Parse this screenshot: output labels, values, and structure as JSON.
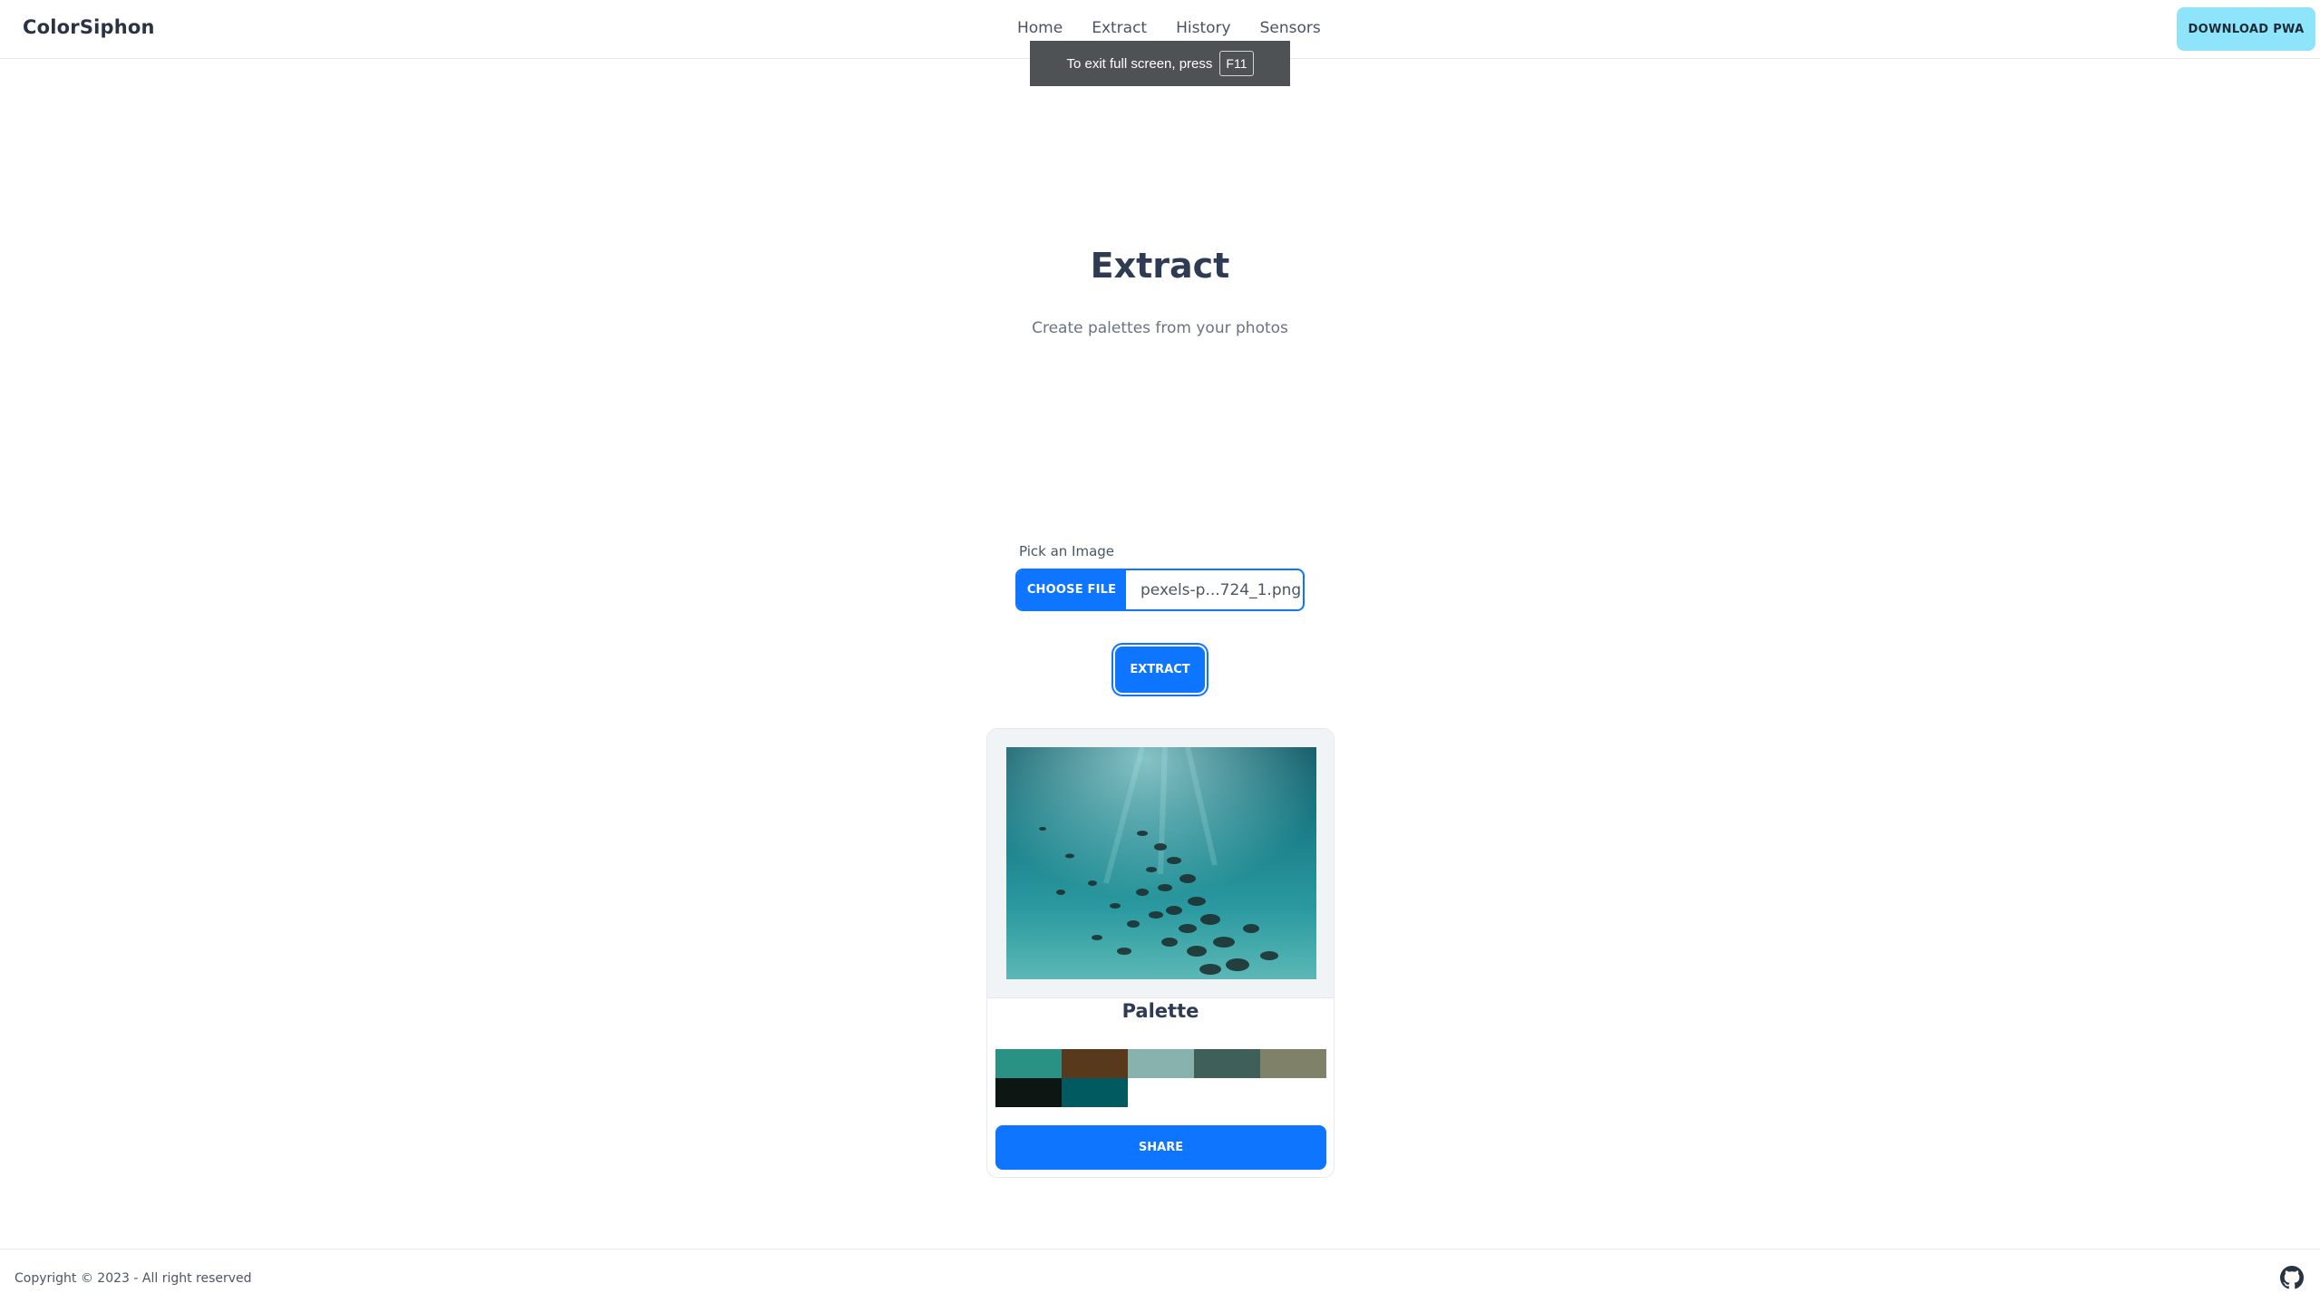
{
  "header": {
    "brand": "ColorSiphon",
    "nav": [
      "Home",
      "Extract",
      "History",
      "Sensors"
    ],
    "download_label": "DOWNLOAD PWA"
  },
  "fullscreen_toast": {
    "text": "To exit full screen, press",
    "key": "F11"
  },
  "hero": {
    "title": "Extract",
    "subtitle": "Create palettes from your photos"
  },
  "picker": {
    "label": "Pick an Image",
    "button_label": "CHOOSE FILE",
    "file_name": "pexels-p...724_1.png"
  },
  "extract_label": "EXTRACT",
  "result": {
    "palette_title": "Palette",
    "swatches": [
      "#2a9185",
      "#59391c",
      "#87b2ae",
      "#3e6058",
      "#7f8169",
      "#0d1612",
      "#025a61"
    ],
    "share_label": "SHARE"
  },
  "footer": {
    "copyright": "Copyright © 2023 - All right reserved"
  },
  "colors": {
    "primary": "#0d75ff",
    "download_bg": "#8ee5fb"
  }
}
